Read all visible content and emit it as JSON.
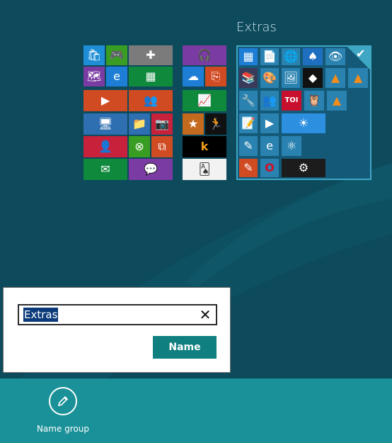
{
  "group": {
    "title": "Extras",
    "selected": true
  },
  "dialog": {
    "input_value": "Extras",
    "clear_icon": "close-icon",
    "clear_glyph": "✕",
    "submit_label": "Name"
  },
  "appbar": {
    "name_group_label": "Name group",
    "name_group_icon": "pencil-icon"
  },
  "tiles": {
    "toi_label": "TOI",
    "k_label": "k"
  },
  "colors": {
    "background": "#0d4a5c",
    "appbar": "#1a9098",
    "accent_button": "#0f7f7f",
    "selection": "#3fa7c4"
  }
}
